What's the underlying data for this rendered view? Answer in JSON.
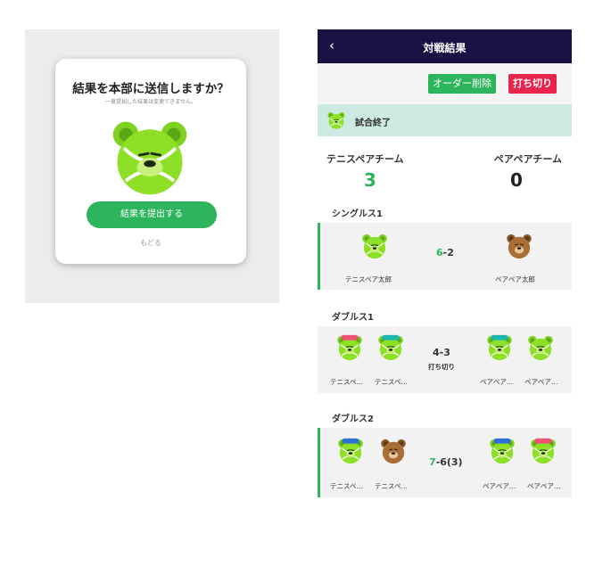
{
  "modal": {
    "title": "結果を本部に送信しますか？",
    "subtitle": "一度提出した結果は変更できません。",
    "submit_label": "結果を提出する",
    "back_label": "もどる"
  },
  "header": {
    "back_glyph": "‹",
    "title": "対戦結果"
  },
  "toolbar": {
    "delete_order_label": "オーダー削除",
    "stop_label": "打ち切り"
  },
  "status": {
    "text": "試合終了"
  },
  "teams": {
    "left_name": "テニスペアチーム",
    "right_name": "ペアペアチーム",
    "left_score": "3",
    "right_score": "0"
  },
  "matches": [
    {
      "label": "シングルス1",
      "score_win": "6",
      "score_rest": "-2",
      "sub": "",
      "left_players": [
        "テニスペア太郎"
      ],
      "right_players": [
        "ペアペア太郎"
      ]
    },
    {
      "label": "ダブルス1",
      "score_win": "",
      "score_rest": "4-3",
      "sub": "打ち切り",
      "left_players": [
        "テニスペ…",
        "テニスペ…"
      ],
      "right_players": [
        "ペアペア…",
        "ペアペア…"
      ]
    },
    {
      "label": "ダブルス2",
      "score_win": "7",
      "score_rest": "-6(3)",
      "sub": "",
      "left_players": [
        "テニスペ…",
        "テニスペ…"
      ],
      "right_players": [
        "ペアペア…",
        "ペアペア…"
      ]
    }
  ],
  "colors": {
    "accent_green": "#2db55d",
    "danger_red": "#e8244d",
    "header_navy": "#1a1243",
    "status_mint": "#cce9e2"
  }
}
